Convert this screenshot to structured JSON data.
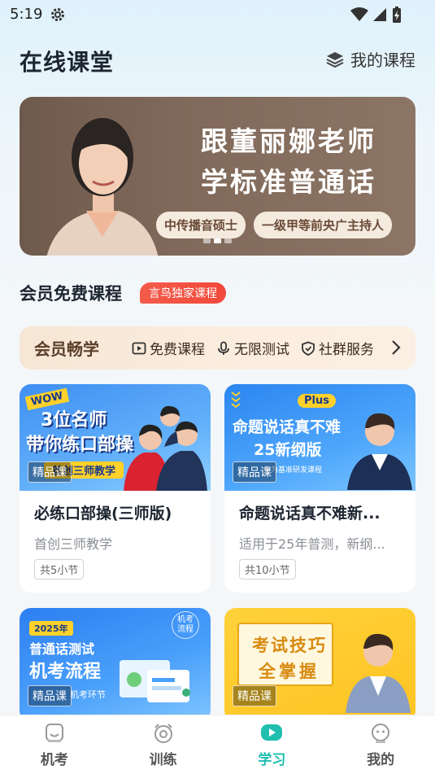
{
  "status_bar": {
    "time": "5:19"
  },
  "header": {
    "title": "在线课堂",
    "my_courses": "我的课程"
  },
  "banner": {
    "title_line1": "跟董丽娜老师",
    "title_line2": "学标准普通话",
    "tags": [
      "中传播音硕士",
      "一级甲等前央广主持人"
    ],
    "slides": 3,
    "active_slide": 1
  },
  "section": {
    "title": "会员免费课程",
    "badge": "言鸟独家课程"
  },
  "perks": {
    "title": "会员畅学",
    "items": [
      {
        "label": "免费课程",
        "icon": "play-square-icon"
      },
      {
        "label": "无限测试",
        "icon": "microphone-icon"
      },
      {
        "label": "社群服务",
        "icon": "shield-icon"
      }
    ]
  },
  "courses": [
    {
      "thumb_text_1": "WOW",
      "thumb_text_2": "3位名师",
      "thumb_text_3": "带你练口部操",
      "thumb_text_4": "首创三师教学",
      "badge": "精品课",
      "title": "必练口部操(三师版)",
      "subtitle": "首创三师教学",
      "lessons": "共5小节"
    },
    {
      "thumb_text_1": "Plus",
      "thumb_text_2": "命题说话真不难",
      "thumb_text_3": "25新纲版",
      "thumb_text_4": "专为基准研发课程",
      "badge": "精品课",
      "title": "命题说话真不难新...",
      "subtitle": "适用于25年普测，新纲...",
      "lessons": "共10小节"
    },
    {
      "thumb_text_1": "2025年",
      "thumb_text_2": "普通话测试",
      "thumb_text_3": "机考流程",
      "thumb_text_4": "机考环节",
      "thumb_text_5": "机考流程",
      "badge": "精品课"
    },
    {
      "thumb_text_2": "考试技巧",
      "thumb_text_3": "全掌握",
      "badge": "精品课"
    }
  ],
  "nav": [
    {
      "label": "机考",
      "icon": "computer-exam-icon"
    },
    {
      "label": "训练",
      "icon": "alarm-clock-icon"
    },
    {
      "label": "学习",
      "icon": "play-button-icon",
      "active": true
    },
    {
      "label": "我的",
      "icon": "profile-face-icon"
    }
  ],
  "colors": {
    "accent": "#1fbfb0",
    "badge_red": "#f2493b",
    "banner_brown": "#7a6454"
  }
}
